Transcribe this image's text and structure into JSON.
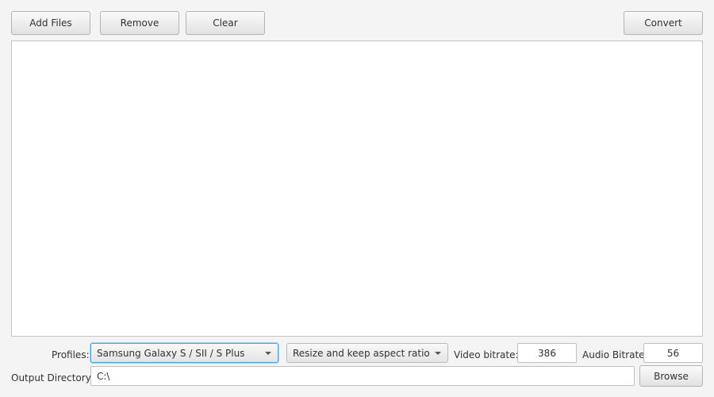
{
  "toolbar": {
    "add_files_label": "Add Files",
    "remove_label": "Remove",
    "clear_label": "Clear",
    "convert_label": "Convert"
  },
  "file_list": {
    "items": []
  },
  "settings": {
    "profiles_label": "Profiles:",
    "profile_selected": "Samsung Galaxy S / SII / S Plus",
    "resize_selected": "Resize and keep aspect ratio",
    "video_bitrate_label": "Video bitrate:",
    "video_bitrate_value": "386",
    "audio_bitrate_label": "Audio Bitrate:",
    "audio_bitrate_value": "56",
    "output_directory_label": "Output Directory:",
    "output_directory_value": "C:\\",
    "browse_label": "Browse"
  },
  "colors": {
    "background": "#f4f4f4",
    "focus_accent": "#4aa3db"
  }
}
